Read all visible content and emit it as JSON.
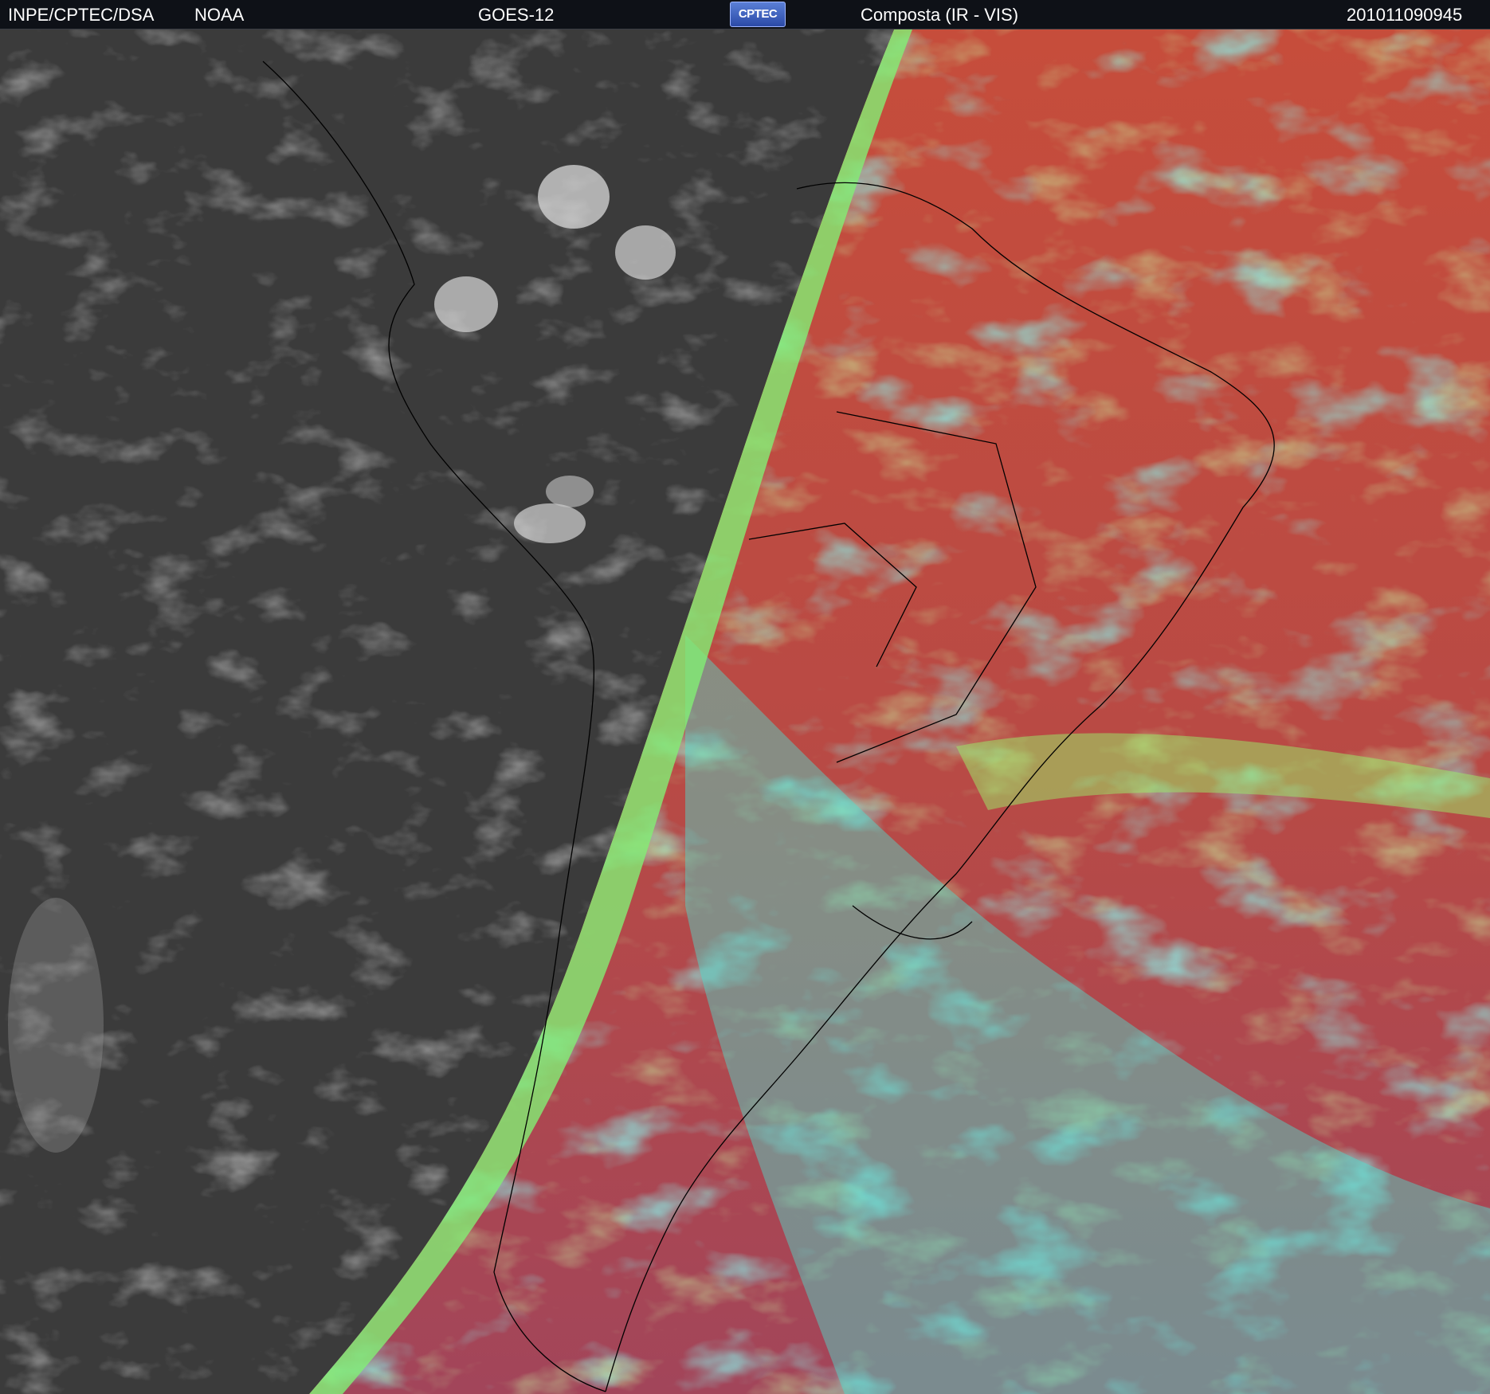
{
  "header": {
    "agency": "INPE/CPTEC/DSA",
    "partner": "NOAA",
    "satellite": "GOES-12",
    "logo_text": "CPTEC",
    "product": "Composta (IR - VIS)",
    "timestamp": "201011090945"
  },
  "image": {
    "night_side_color": "#3a3a3a",
    "day_land_color": "#b54a3e",
    "day_ocean_color": "#c84d3a",
    "cloud_cyan": "#3fe6d8",
    "cloud_green": "#8ef06a",
    "terminator_color": "#7ef07a",
    "coastline_color": "#000000"
  }
}
